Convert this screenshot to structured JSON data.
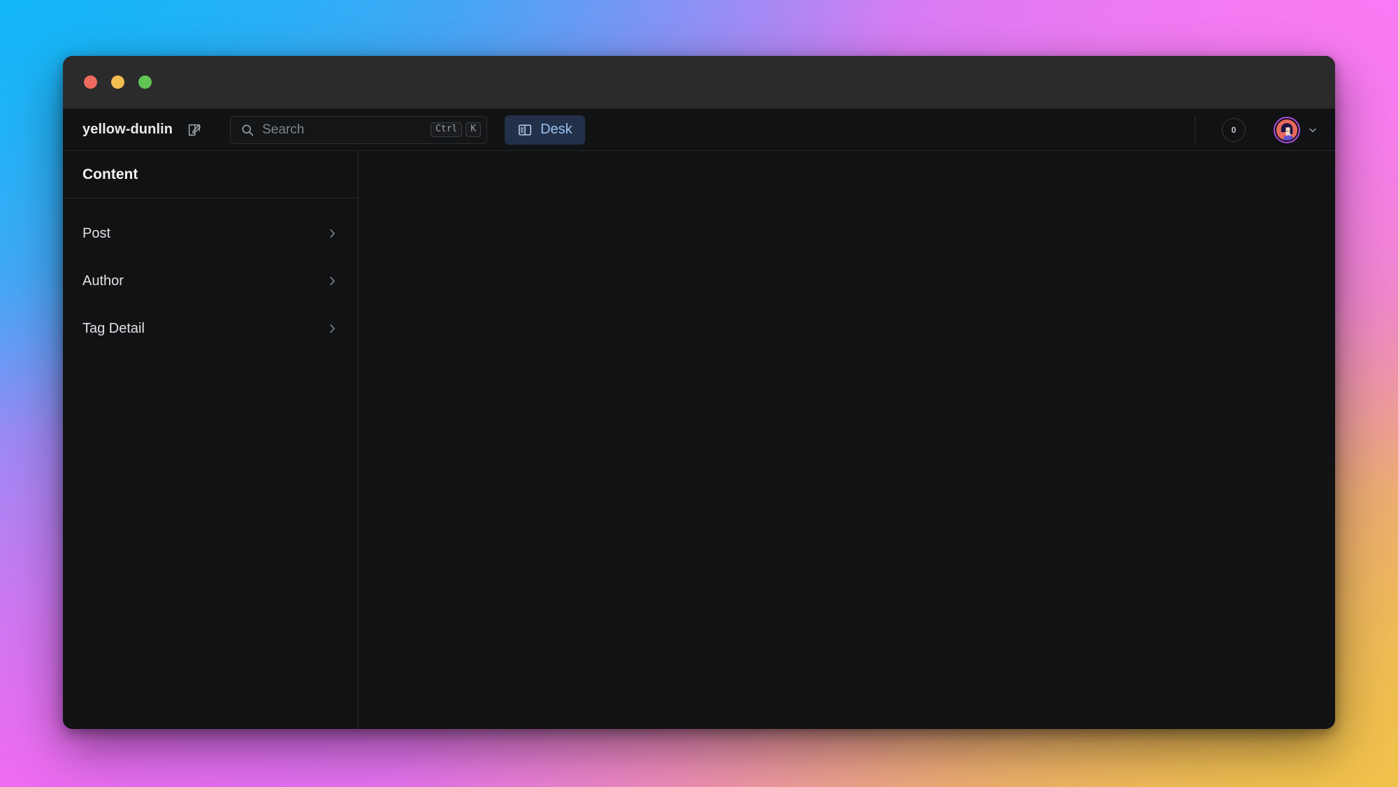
{
  "window": {
    "traffic_lights": [
      "close",
      "minimize",
      "maximize"
    ]
  },
  "toolbar": {
    "project_title": "yellow-dunlin",
    "compose_icon": "edit-square-pencil-icon",
    "search": {
      "icon": "search-icon",
      "placeholder": "Search",
      "value": "",
      "shortcut_keys": [
        "Ctrl",
        "K"
      ]
    },
    "desk_button": {
      "label": "Desk",
      "icon": "panel-layout-icon",
      "active": true,
      "bg_color": "#223049",
      "text_color": "#9cc2f0"
    },
    "notification_badge": {
      "count": "0",
      "icon": "notification-count-badge"
    },
    "avatar": {
      "icon": "user-avatar",
      "ring_color": "#b14ce0",
      "bg_color": "#E8685F",
      "hair_color": "#1E1440",
      "skin_color": "#F4DBC9"
    },
    "avatar_menu_icon": "chevron-down-icon"
  },
  "sidebar": {
    "header": "Content",
    "items": [
      {
        "label": "Post",
        "chevron": "chevron-right-icon"
      },
      {
        "label": "Author",
        "chevron": "chevron-right-icon"
      },
      {
        "label": "Tag Detail",
        "chevron": "chevron-right-icon"
      }
    ]
  },
  "main": {
    "content": ""
  },
  "colors": {
    "window_bg": "#111213",
    "titlebar_bg": "#2B2B2C",
    "border": "#262729",
    "accent_blue": "#9cc2f0",
    "text_primary": "#f2f3f5",
    "text_muted": "#8c9196"
  }
}
